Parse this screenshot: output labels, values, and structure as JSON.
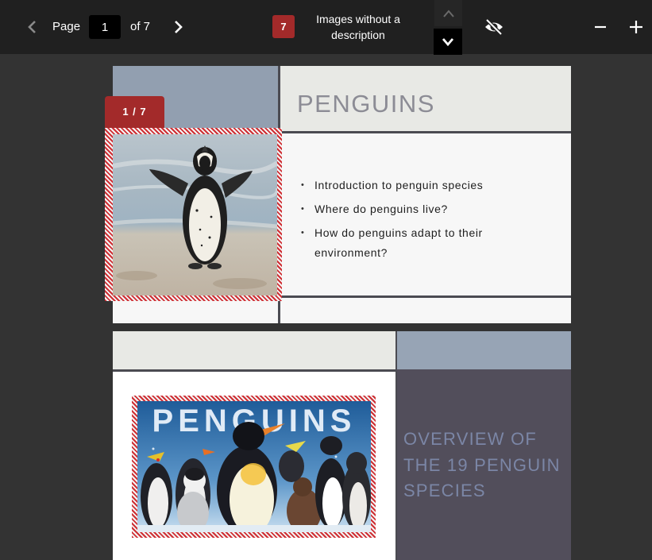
{
  "toolbar": {
    "page_label": "Page",
    "page_value": "1",
    "of_label": "of 7",
    "image_count": "7",
    "images_label": "Images without a description"
  },
  "icons": {
    "prev": "chevron-left-icon",
    "next": "chevron-right-icon",
    "up": "chevron-up-icon",
    "down": "chevron-down-icon",
    "visibility": "eye-slash-icon",
    "zoom_out": "minus-icon",
    "zoom_in": "plus-icon"
  },
  "image_flag": "1 / 7",
  "slide1": {
    "title": "PENGUINS",
    "bullets": [
      "Introduction to penguin species",
      "Where do penguins live?",
      "How do penguins adapt to their environment?"
    ]
  },
  "slide2": {
    "title": "OVERVIEW OF THE 19 PENGUIN SPECIES",
    "image_text": "PENGUINS"
  },
  "colors": {
    "toolbar_bg": "#202020",
    "workspace_bg": "#333333",
    "accent_red": "#a32a2a",
    "hatch_red": "#cf2f34",
    "slide_blue": "#929fb0",
    "slide_dark": "#524e5b",
    "slide_divider": "#4b4b52"
  }
}
